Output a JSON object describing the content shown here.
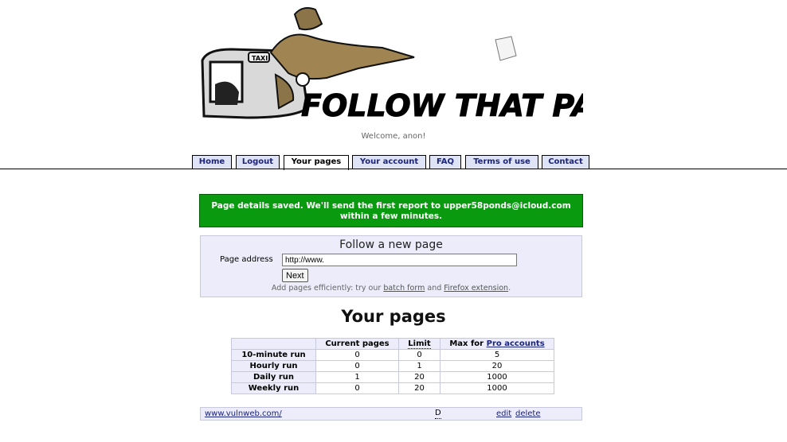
{
  "banner": {
    "logo_text": "FOLLOW THAT PAGE!",
    "taxi_sign": "TAXI"
  },
  "welcome": "Welcome, anon!",
  "tabs": [
    {
      "label": "Home"
    },
    {
      "label": "Logout"
    },
    {
      "label": "Your pages",
      "active": true
    },
    {
      "label": "Your account"
    },
    {
      "label": "FAQ"
    },
    {
      "label": "Terms of use"
    },
    {
      "label": "Contact"
    }
  ],
  "notice": {
    "line1": "Page details saved. We'll send the first report to upper58ponds@icloud.com",
    "line2": "within a few minutes.",
    "color": "#0a9a10"
  },
  "follow": {
    "title": "Follow a new page",
    "address_label": "Page address",
    "address_value": "http://www.",
    "next_label": "Next",
    "hint_prefix": "Add pages efficiently: try our",
    "batch_link": "batch form",
    "hint_and": "and",
    "firefox_link": "Firefox extension",
    "hint_suffix": "."
  },
  "your_pages": {
    "title": "Your pages",
    "headers": {
      "current": "Current pages",
      "limit": "Limit",
      "max_prefix": "Max for",
      "max_link": "Pro accounts"
    },
    "rows": [
      {
        "label": "10-minute run",
        "current": "0",
        "limit": "0",
        "max": "5"
      },
      {
        "label": "Hourly run",
        "current": "0",
        "limit": "1",
        "max": "20"
      },
      {
        "label": "Daily run",
        "current": "1",
        "limit": "20",
        "max": "1000"
      },
      {
        "label": "Weekly run",
        "current": "0",
        "limit": "20",
        "max": "1000"
      }
    ]
  },
  "pages": [
    {
      "url": "www.vulnweb.com/",
      "frequency": "D",
      "edit": "edit",
      "delete": "delete"
    }
  ]
}
